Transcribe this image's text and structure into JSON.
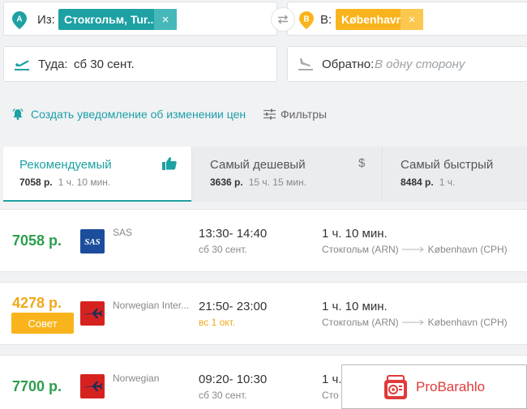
{
  "search": {
    "from": {
      "label": "Из:",
      "pin_letter": "A",
      "value": "Стокгольм, Tur...",
      "pin_color": "#1da1a3"
    },
    "to": {
      "label": "В:",
      "pin_letter": "B",
      "value": "København",
      "pin_color": "#f9b41d"
    },
    "depart": {
      "label": "Туда:",
      "value": "сб 30 сент."
    },
    "return": {
      "label": "Обратно:",
      "placeholder": "В одну сторону"
    },
    "clear_glyph": "×"
  },
  "actions": {
    "price_alert": "Создать уведомление об изменении цен",
    "filters": "Фильтры"
  },
  "tabs": [
    {
      "title": "Рекомендуемый",
      "price": "7058 р.",
      "duration": "1 ч. 10 мин.",
      "active": true
    },
    {
      "title": "Самый дешевый",
      "price": "3636 р.",
      "duration": "15 ч. 15 мин.",
      "icon_glyph": "$"
    },
    {
      "title": "Самый быстрый",
      "price": "8484 р.",
      "duration": "1 ч."
    }
  ],
  "results": [
    {
      "price": "7058 р.",
      "airline": "SAS",
      "logo_text": "SAS",
      "times": "13:30- 14:40",
      "date": "сб 30 сент.",
      "duration": "1 ч. 10 мин.",
      "from": "Стокгольм (ARN)",
      "to": "København (CPH)"
    },
    {
      "price": "4278 р.",
      "badge": "Совет",
      "airline": "Norwegian Inter...",
      "times": "21:50- 23:00",
      "date": "вс 1 окт.",
      "duration": "1 ч. 10 мин.",
      "from": "Стокгольм (ARN)",
      "to": "København (CPH)"
    },
    {
      "price": "7700 р.",
      "airline": "Norwegian",
      "times": "09:20- 10:30",
      "date": "сб 30 сент.",
      "duration": "1 ч.",
      "from": "Сто"
    }
  ],
  "watermark": {
    "text": "ProBarahlo"
  },
  "colors": {
    "accent": "#1da1a3",
    "highlight": "#f9b41d",
    "price_green": "#2e9e4e"
  }
}
